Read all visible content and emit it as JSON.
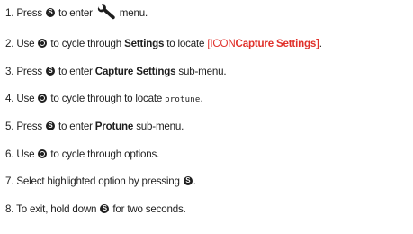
{
  "steps": [
    {
      "num": "1.",
      "t1": "Press",
      "t2": "to enter",
      "t3": "menu."
    },
    {
      "num": "2.",
      "t1": "Use",
      "t2": "to cycle through",
      "t3": "Settings",
      "t4": "to locate",
      "t5": "[ICON",
      "t6": "Capture Settings]",
      "t7": "."
    },
    {
      "num": "3.",
      "t1": "Press",
      "t2": "to enter",
      "t3": "Capture Settings",
      "t4": "sub-menu."
    },
    {
      "num": "4.",
      "t1": "Use",
      "t2": "to cycle through to locate",
      "t3": "protune",
      "t4": "."
    },
    {
      "num": "5.",
      "t1": "Press",
      "t2": "to enter",
      "t3": "Protune",
      "t4": "sub-menu."
    },
    {
      "num": "6.",
      "t1": "Use",
      "t2": "to cycle through options."
    },
    {
      "num": "7.",
      "t1": "Select highlighted option by pressing",
      "t2": "."
    },
    {
      "num": "8.",
      "t1": "To exit, hold down",
      "t2": "for two seconds."
    }
  ],
  "icons": {
    "shutter": "shutter-select-button-icon",
    "mode": "mode-button-icon",
    "settings": "wrench-settings-icon"
  },
  "colors": {
    "text": "#1e1e1e",
    "placeholder": "#e0302a"
  }
}
